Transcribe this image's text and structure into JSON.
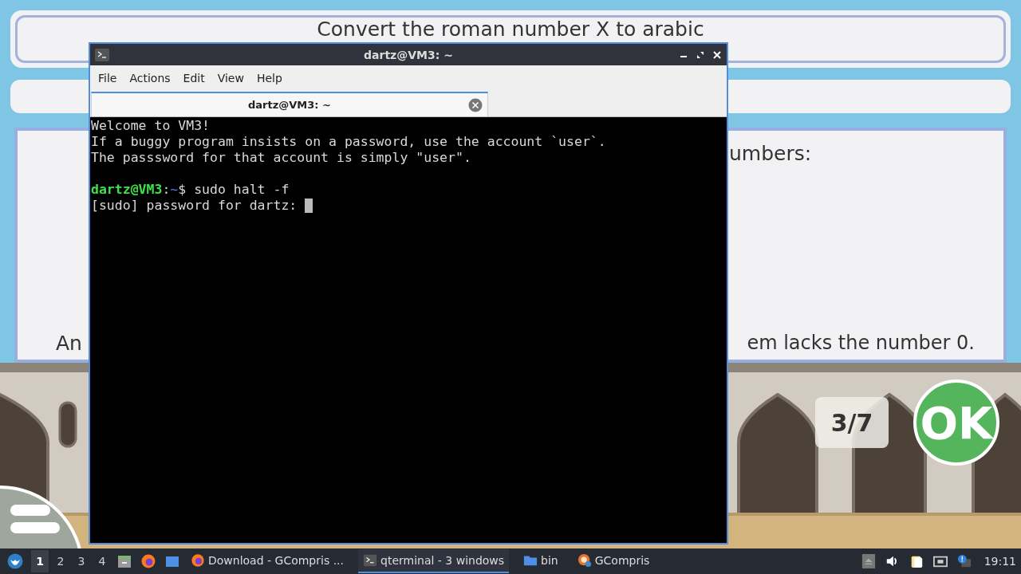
{
  "game": {
    "instruction": "Convert the roman number X to arabic",
    "panel_texts": [
      {
        "kind": "top_right",
        "text": "umbers:"
      },
      {
        "kind": "bottom_left",
        "text": "An"
      },
      {
        "kind": "bottom_right",
        "text": "em lacks the number 0."
      }
    ],
    "score": "3/7",
    "ok_button": "OK"
  },
  "terminal": {
    "title": "dartz@VM3: ~",
    "menu": [
      "File",
      "Actions",
      "Edit",
      "View",
      "Help"
    ],
    "tabs": [
      {
        "label": "dartz@VM3: ~",
        "selected": true
      }
    ],
    "lines": [
      {
        "kind": "text",
        "text": "Welcome to VM3!"
      },
      {
        "kind": "text",
        "text": "If a buggy program insists on a password, use the account `user`."
      },
      {
        "kind": "text",
        "text": "The passsword for that account is simply \"user\"."
      },
      {
        "kind": "blank"
      },
      {
        "kind": "prompt",
        "user_host": "dartz@VM3",
        "separator": ":",
        "path": "~",
        "command": "$ sudo halt -f"
      },
      {
        "kind": "input",
        "text": "[sudo] password for dartz:",
        "cursor": true
      }
    ]
  },
  "taskbar": {
    "workspaces": [
      {
        "label": "1",
        "selected": true
      },
      {
        "label": "2",
        "selected": false
      },
      {
        "label": "3",
        "selected": false
      },
      {
        "label": "4",
        "selected": false
      }
    ],
    "tasks": [
      {
        "label": "Download - GCompris ...",
        "kind": "browser",
        "selected": false
      },
      {
        "label": "qterminal - 3 windows",
        "kind": "terminal",
        "selected": true
      },
      {
        "label": "bin",
        "kind": "folder",
        "selected": false
      },
      {
        "label": "GCompris",
        "kind": "gcompris",
        "selected": false
      }
    ],
    "clock": "19:11"
  }
}
